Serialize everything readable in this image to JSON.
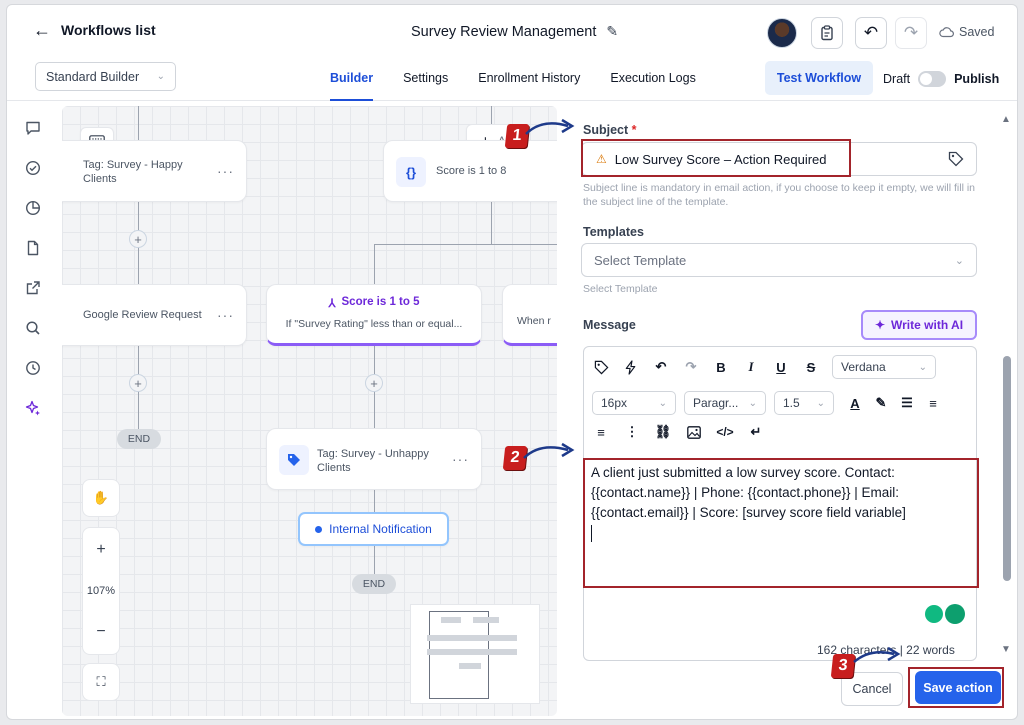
{
  "header": {
    "back_label": "Workflows list",
    "title": "Survey Review Management",
    "saved_label": "Saved"
  },
  "subbar": {
    "builder_select": "Standard Builder",
    "tabs": [
      {
        "label": "Builder",
        "active": true
      },
      {
        "label": "Settings"
      },
      {
        "label": "Enrollment History"
      },
      {
        "label": "Execution Logs"
      }
    ],
    "test_workflow": "Test Workflow",
    "draft": "Draft",
    "publish": "Publish"
  },
  "canvas": {
    "node_happy": "Tag: Survey - Happy Clients",
    "node_score": "Score is 1 to 8",
    "node_google": "Google Review Request",
    "node_branch_title": "Score is 1 to 5",
    "node_branch_desc": "If \"Survey Rating\" less than or equal...",
    "node_when": "When r",
    "node_unhappy": "Tag: Survey - Unhappy Clients",
    "node_internal": "Internal Notification",
    "add_partial": "A",
    "end_label": "END",
    "zoom": "107%"
  },
  "panel": {
    "subject_label": "Subject",
    "subject_value": "Low Survey Score – Action Required",
    "subject_hint": "Subject line is mandatory in email action, if you choose to keep it empty, we will fill in the subject line of the template.",
    "templates_label": "Templates",
    "templates_placeholder": "Select Template",
    "templates_hint": "Select Template",
    "message_label": "Message",
    "write_ai": "Write with AI",
    "font": "Verdana",
    "font_size": "16px",
    "block": "Paragr...",
    "line_height": "1.5",
    "message_text": "A client just submitted a low survey score. Contact: {{contact.name}} | Phone: {{contact.phone}} | Email: {{contact.email}} | Score: [survey score field variable]",
    "counter": "162 characters | 22 words",
    "cancel": "Cancel",
    "save": "Save action"
  },
  "annotations": [
    "1",
    "2",
    "3"
  ],
  "colors": {
    "accent": "#2563eb",
    "annotation_red": "#c81e1e",
    "branch_purple": "#7c3aed"
  }
}
